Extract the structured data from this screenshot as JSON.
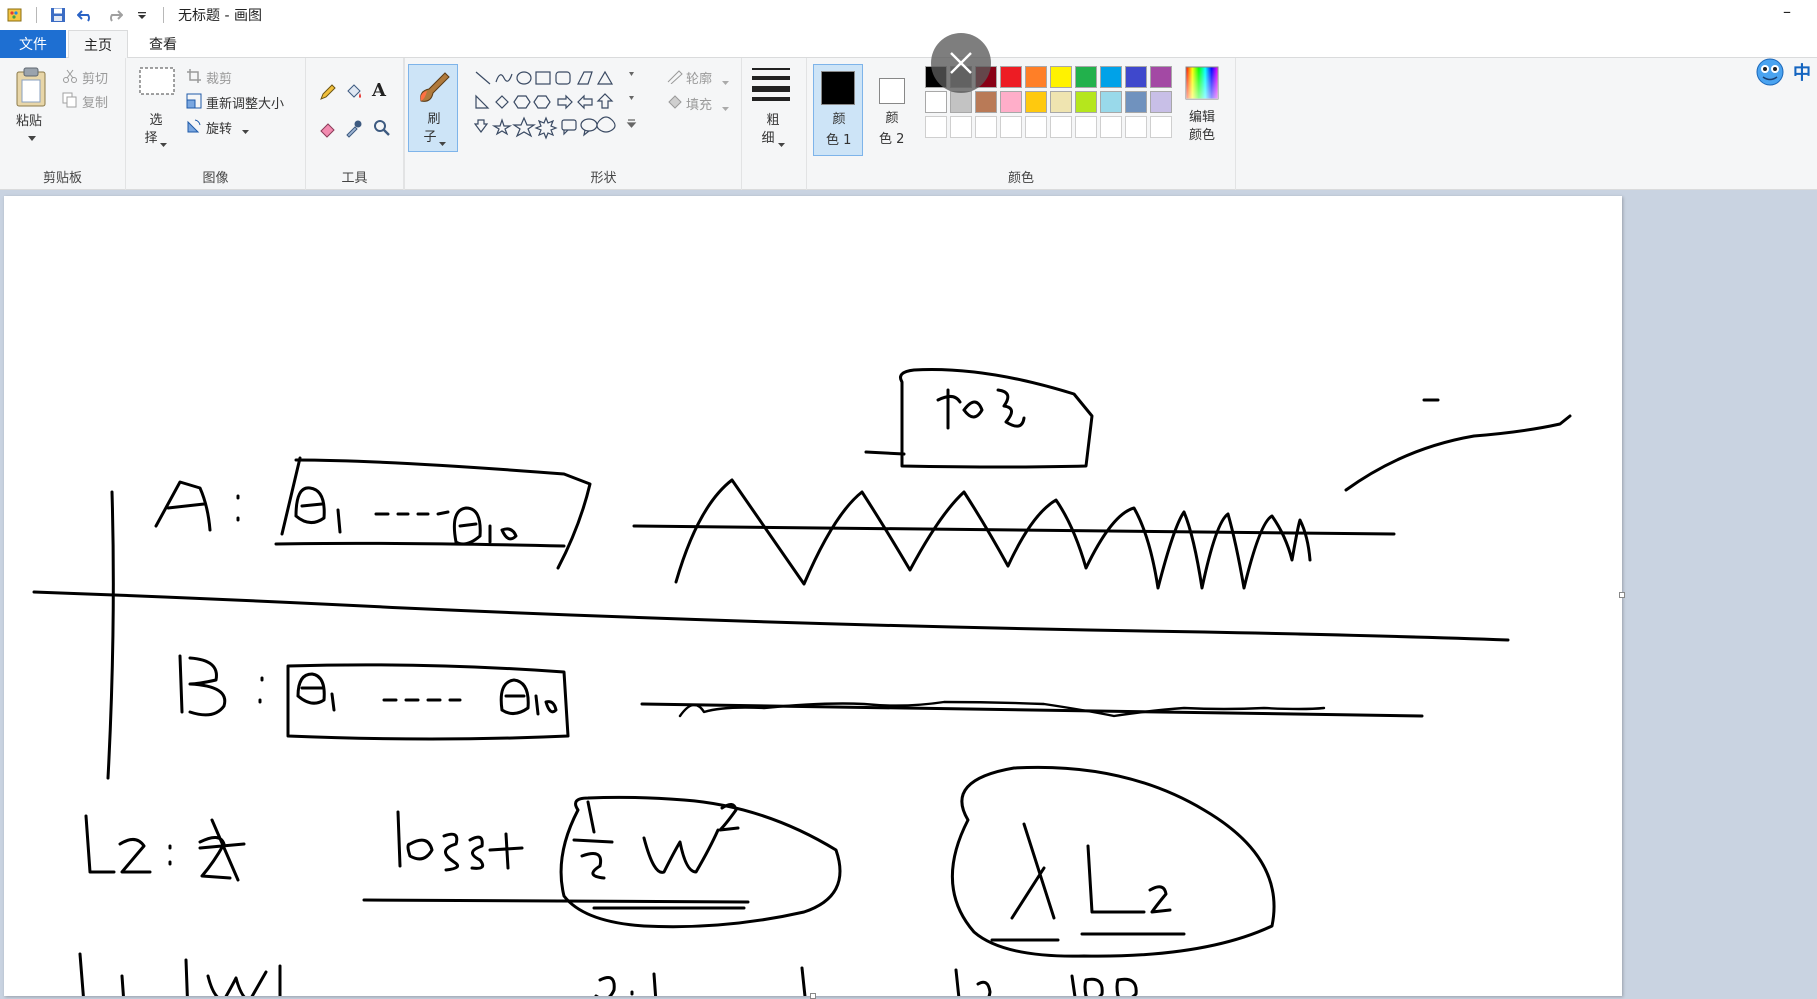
{
  "window": {
    "title": "无标题 - 画图",
    "minimize_glyph": "–"
  },
  "quick_access": {
    "icons": [
      "paint-app-icon",
      "save-icon",
      "undo-icon",
      "redo-icon",
      "customize-dropdown-icon"
    ]
  },
  "tabs": [
    {
      "label": "文件",
      "active": false
    },
    {
      "label": "主页",
      "active": true
    },
    {
      "label": "查看",
      "active": false
    }
  ],
  "ribbon": {
    "clipboard": {
      "label": "剪贴板",
      "paste": "粘贴",
      "cut": "剪切",
      "copy": "复制"
    },
    "image": {
      "label": "图像",
      "select": [
        "选",
        "择"
      ],
      "crop": "裁剪",
      "resize": "重新调整大小",
      "rotate": "旋转"
    },
    "tools": {
      "label": "工具",
      "text_glyph": "A"
    },
    "brushes": {
      "label": [
        "刷",
        "子"
      ]
    },
    "shapes": {
      "label": "形状",
      "outline": "轮廓",
      "fill": "填充"
    },
    "size": {
      "label": [
        "粗",
        "细"
      ]
    },
    "colors": {
      "label": "颜色",
      "color1": [
        "颜",
        "色 1"
      ],
      "color2": [
        "颜",
        "色 2"
      ],
      "edit": [
        "编辑",
        "颜色"
      ],
      "color1_value": "#000000",
      "color2_value": "#ffffff",
      "palette_row1": [
        "#000000",
        "#7f7f7f",
        "#880015",
        "#ed1c24",
        "#ff7f27",
        "#fff200",
        "#22b14c",
        "#00a2e8",
        "#3f48cc",
        "#a349a4"
      ],
      "palette_row2": [
        "#ffffff",
        "#c3c3c3",
        "#b97a57",
        "#ffaec9",
        "#ffc90e",
        "#efe4b0",
        "#b5e61d",
        "#99d9ea",
        "#7092be",
        "#c8bfe7"
      ],
      "palette_row3": [
        "#ffffff",
        "#ffffff",
        "#ffffff",
        "#ffffff",
        "#ffffff",
        "#ffffff",
        "#ffffff",
        "#ffffff",
        "#ffffff",
        "#ffffff"
      ]
    }
  },
  "ime": {
    "label": "中"
  },
  "canvas": {
    "background": "#ffffff"
  }
}
